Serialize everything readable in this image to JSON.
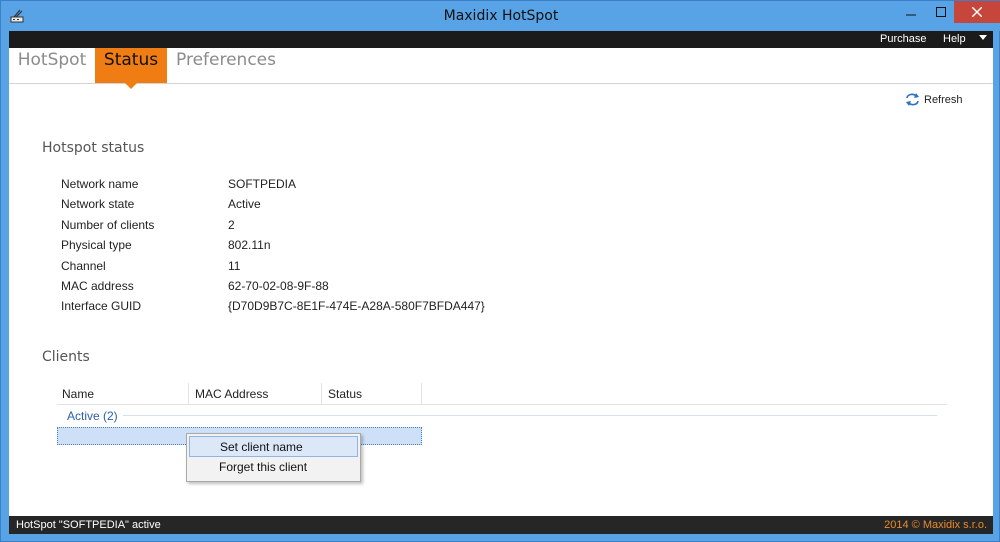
{
  "window": {
    "title": "Maxidix HotSpot",
    "icon": "hotspot-app-icon"
  },
  "menu": {
    "purchase": "Purchase",
    "help": "Help"
  },
  "tabs": [
    {
      "label": "HotSpot",
      "active": false
    },
    {
      "label": "Status",
      "active": true
    },
    {
      "label": "Preferences",
      "active": false
    }
  ],
  "toolbar": {
    "refresh_label": "Refresh"
  },
  "hotspot_status": {
    "title": "Hotspot status",
    "rows": [
      {
        "label": "Network name",
        "value": "SOFTPEDIA"
      },
      {
        "label": "Network state",
        "value": "Active"
      },
      {
        "label": "Number of clients",
        "value": "2"
      },
      {
        "label": "Physical type",
        "value": "802.11n"
      },
      {
        "label": "Channel",
        "value": "11"
      },
      {
        "label": "MAC address",
        "value": "62-70-02-08-9F-88"
      },
      {
        "label": "Interface GUID",
        "value": "{D70D9B7C-8E1F-474E-A28A-580F7BFDA447}"
      }
    ]
  },
  "clients": {
    "title": "Clients",
    "columns": [
      "Name",
      "MAC Address",
      "Status"
    ],
    "group_label": "Active (2)"
  },
  "context_menu": {
    "items": [
      "Set client name",
      "Forget this client"
    ]
  },
  "statusbar": {
    "left": "HotSpot \"SOFTPEDIA\" active",
    "right": "2014 © Maxidix s.r.o."
  },
  "colors": {
    "accent": "#f07c14",
    "titlebar": "#57a3e6",
    "close": "#c7463b"
  }
}
